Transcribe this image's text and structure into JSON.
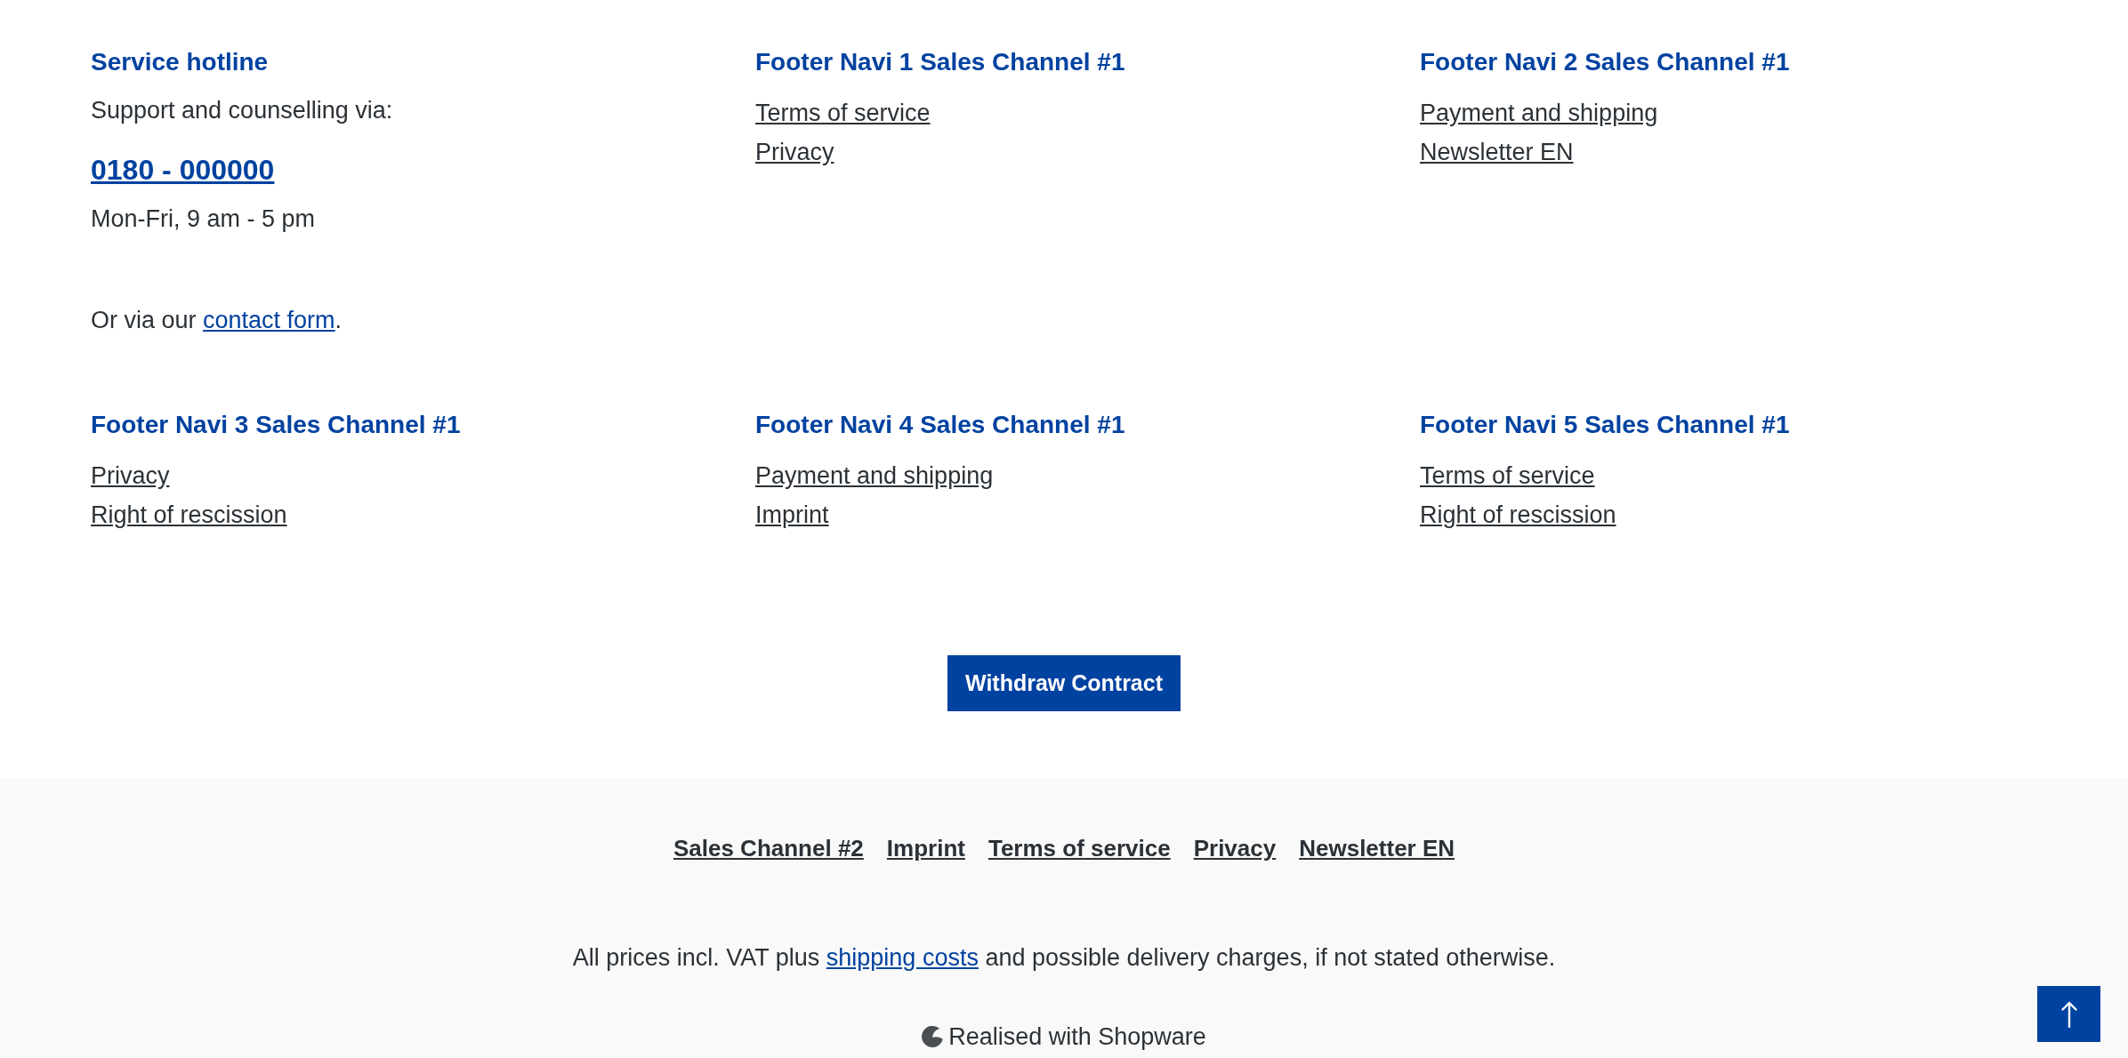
{
  "columns": [
    {
      "kind": "hotline",
      "title": "Service hotline",
      "intro": "Support and counselling via:",
      "phone": "0180 - 000000",
      "hours": "Mon-Fri, 9 am - 5 pm",
      "contact_note": {
        "before": "Or via our ",
        "link": "contact form",
        "after": "."
      }
    },
    {
      "kind": "links",
      "title": "Footer Navi 1 Sales Channel #1",
      "links": [
        "Terms of service",
        "Privacy"
      ]
    },
    {
      "kind": "links",
      "title": "Footer Navi 2 Sales Channel #1",
      "links": [
        "Payment and shipping",
        "Newsletter EN"
      ]
    },
    {
      "kind": "links",
      "title": "Footer Navi 3 Sales Channel #1",
      "links": [
        "Privacy",
        "Right of rescission"
      ]
    },
    {
      "kind": "links",
      "title": "Footer Navi 4 Sales Channel #1",
      "links": [
        "Payment and shipping",
        "Imprint"
      ]
    },
    {
      "kind": "links",
      "title": "Footer Navi 5 Sales Channel #1",
      "links": [
        "Terms of service",
        "Right of rescission"
      ]
    }
  ],
  "withdraw_button": "Withdraw Contract",
  "bottom_links": [
    "Sales Channel #2",
    "Imprint",
    "Terms of service",
    "Privacy",
    "Newsletter EN"
  ],
  "price_notice": {
    "before": "All prices incl. VAT plus ",
    "link": "shipping costs",
    "after": " and possible delivery charges, if not stated otherwise."
  },
  "credit": "Realised with Shopware"
}
